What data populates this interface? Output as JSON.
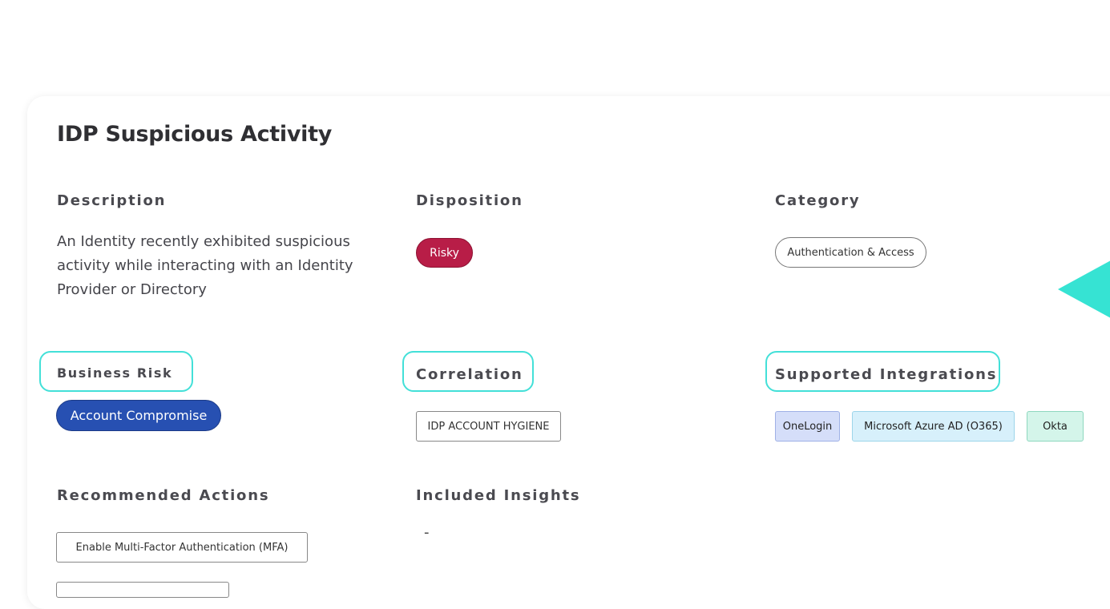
{
  "card": {
    "title": "IDP Suspicious Activity"
  },
  "description": {
    "label": "Description",
    "text": "An Identity recently exhibited suspicious activity while interacting with an Identity Provider or Directory"
  },
  "disposition": {
    "label": "Disposition",
    "value": "Risky",
    "color": "#b81d47"
  },
  "category": {
    "label": "Category",
    "value": "Authentication & Access"
  },
  "business_risk": {
    "label": "Business Risk",
    "value": "Account Compromise",
    "color": "#2750b2"
  },
  "correlation": {
    "label": "Correlation",
    "value": "IDP ACCOUNT HYGIENE"
  },
  "supported_integrations": {
    "label": "Supported Integrations",
    "items": [
      "OneLogin",
      "Microsoft Azure AD (O365)",
      "Okta"
    ]
  },
  "recommended_actions": {
    "label": "Recommended Actions",
    "items": [
      "Enable Multi-Factor Authentication (MFA)"
    ]
  },
  "included_insights": {
    "label": "Included Insights",
    "value": "-"
  },
  "accent_color": "#43e0d8"
}
